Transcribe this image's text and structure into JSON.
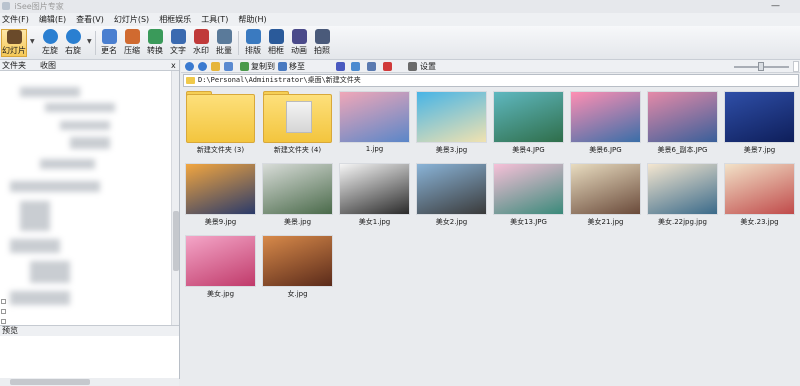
{
  "title_bar": {
    "title": "iSee图片专家",
    "minimize": "—"
  },
  "menu": [
    "文件(F)",
    "编辑(E)",
    "查看(V)",
    "幻灯片(S)",
    "相框娱乐",
    "工具(T)",
    "帮助(H)"
  ],
  "toolbar": [
    {
      "label": "幻灯片",
      "icon": "slideshow-icon",
      "color": "#6a4a2a"
    },
    {
      "label": "左旋",
      "icon": "rotate-left-icon",
      "color": "#2a7fd1"
    },
    {
      "label": "右旋",
      "icon": "rotate-right-icon",
      "color": "#2a7fd1"
    },
    {
      "label": "更名",
      "icon": "rename-icon",
      "color": "#4a7fd0"
    },
    {
      "label": "压缩",
      "icon": "compress-icon",
      "color": "#d06a30"
    },
    {
      "label": "转换",
      "icon": "convert-icon",
      "color": "#3a9a5a"
    },
    {
      "label": "文字",
      "icon": "text-icon",
      "color": "#3a6ab0"
    },
    {
      "label": "水印",
      "icon": "watermark-icon",
      "color": "#c03a3a"
    },
    {
      "label": "批量",
      "icon": "batch-icon",
      "color": "#5a7a9a"
    },
    {
      "label": "排版",
      "icon": "layout-icon",
      "color": "#3a7ac0"
    },
    {
      "label": "相框",
      "icon": "frame-icon",
      "color": "#2a5a9a"
    },
    {
      "label": "动画",
      "icon": "animation-icon",
      "color": "#4a4a8a"
    },
    {
      "label": "拍照",
      "icon": "camera-icon",
      "color": "#4a5a7a"
    }
  ],
  "left_panel": {
    "tabs": [
      "文件夹",
      "收图"
    ],
    "close": "x",
    "preview_label": "预览"
  },
  "right_toolbar": {
    "copy_to": "复制到",
    "move_to": "移至",
    "settings": "设置"
  },
  "path": "D:\\Personal\\Administrator\\桌面\\新建文件夹",
  "thumbnails": [
    {
      "caption": "新建文件夹 (3)",
      "kind": "folder",
      "colors": [
        "#fde07b",
        "#f3c53e"
      ]
    },
    {
      "caption": "新建文件夹 (4)",
      "kind": "folder-photo",
      "colors": [
        "#fde07b",
        "#f3c53e"
      ]
    },
    {
      "caption": "1.jpg",
      "kind": "photo",
      "colors": [
        "#f0a7b8",
        "#5a86c8"
      ]
    },
    {
      "caption": "美景3.jpg",
      "kind": "photo",
      "colors": [
        "#47b4e6",
        "#f1e2b0"
      ]
    },
    {
      "caption": "美景4.JPG",
      "kind": "photo",
      "colors": [
        "#5fb8c0",
        "#2f6e4a"
      ]
    },
    {
      "caption": "美景6.JPG",
      "kind": "photo",
      "colors": [
        "#ff8fb3",
        "#3a6ea8"
      ]
    },
    {
      "caption": "美景6_副本.JPG",
      "kind": "photo",
      "colors": [
        "#e58aa8",
        "#395f9a"
      ]
    },
    {
      "caption": "美景7.jpg",
      "kind": "photo",
      "colors": [
        "#2f4fa8",
        "#0e1e5a"
      ]
    },
    {
      "caption": "美景9.jpg",
      "kind": "photo",
      "colors": [
        "#f2a640",
        "#2a3a6a"
      ]
    },
    {
      "caption": "美景.jpg",
      "kind": "photo",
      "colors": [
        "#d8dcd8",
        "#4a6a4a"
      ]
    },
    {
      "caption": "美女1.jpg",
      "kind": "photo",
      "colors": [
        "#f6f6f6",
        "#2a2a2a"
      ]
    },
    {
      "caption": "美女2.jpg",
      "kind": "photo",
      "colors": [
        "#8ab4d8",
        "#3a3a3a"
      ]
    },
    {
      "caption": "美女13.JPG",
      "kind": "photo",
      "colors": [
        "#f7c0d8",
        "#3a8a7a"
      ]
    },
    {
      "caption": "美女21.jpg",
      "kind": "photo",
      "colors": [
        "#e8dcc0",
        "#6a4a3a"
      ]
    },
    {
      "caption": "美女.22jpg.jpg",
      "kind": "photo",
      "colors": [
        "#f4e6d0",
        "#3a6a8a"
      ]
    },
    {
      "caption": "美女.23.jpg",
      "kind": "photo",
      "colors": [
        "#f2e2c8",
        "#c04a4a"
      ]
    },
    {
      "caption": "美女.jpg",
      "kind": "photo",
      "colors": [
        "#f4a6c8",
        "#c03a6a"
      ]
    },
    {
      "caption": "女.jpg",
      "kind": "photo",
      "colors": [
        "#d88a4a",
        "#5a2a1a"
      ]
    }
  ]
}
